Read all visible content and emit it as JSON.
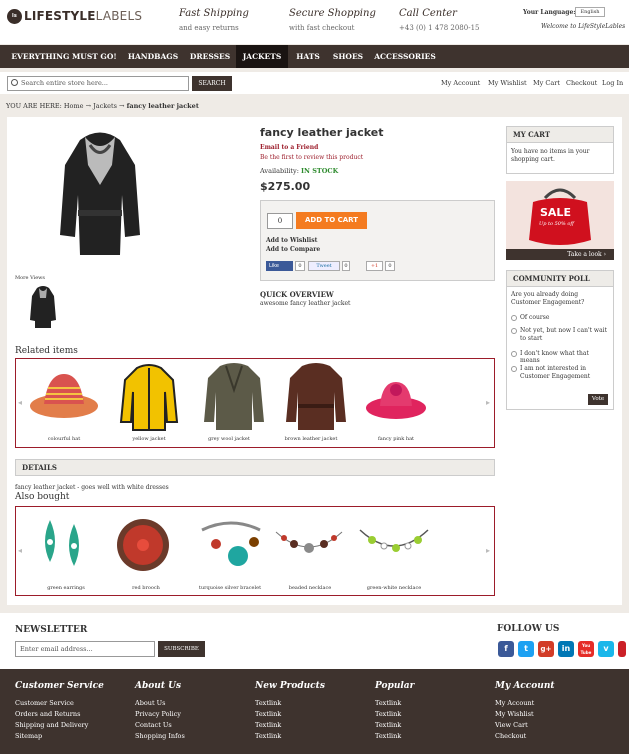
{
  "header": {
    "logo_text_bold": "LIFESTYLE",
    "logo_text_light": "LABELS",
    "logo_badge": "ls",
    "promo": [
      {
        "title": "Fast Shipping",
        "sub": "and easy returns"
      },
      {
        "title": "Secure Shopping",
        "sub": "with fast checkout"
      },
      {
        "title": "Call Center",
        "sub": "+43 (0) 1 478 2080-15"
      }
    ],
    "language_label": "Your Language:",
    "language_value": "English",
    "welcome": "Welcome to LifeStyleLables"
  },
  "nav": [
    "EVERYTHING MUST GO!",
    "HANDBAGS",
    "DRESSES",
    "JACKETS",
    "HATS",
    "SHOES",
    "ACCESSORIES"
  ],
  "search": {
    "placeholder": "Search entire store here...",
    "button": "SEARCH"
  },
  "account_links": [
    "My Account",
    "My Wishlist",
    "My Cart",
    "Checkout",
    "Log In"
  ],
  "breadcrumb": {
    "prefix": "YOU ARE HERE:",
    "home": "Home",
    "sep": "→",
    "cat": "Jackets",
    "current": "fancy leather jacket"
  },
  "product": {
    "name": "fancy leather jacket",
    "email": "Email to a Friend",
    "review": "Be the first to review this product",
    "availability_label": "Availability:",
    "availability_value": "IN STOCK",
    "price": "$275.00",
    "qty": "0",
    "add_to_cart": "ADD TO CART",
    "wishlist": "Add to Wishlist",
    "compare": "Add to Compare",
    "like": "Like",
    "like_count": "0",
    "tweet": "Tweet",
    "tweet_count": "0",
    "gplus": "+1",
    "gplus_count": "0",
    "more_views": "More Views",
    "quick_overview_title": "QUICK OVERVIEW",
    "quick_overview_text": "awesome fancy leather jacket"
  },
  "related": {
    "title": "Related items",
    "items": [
      "colourful hat",
      "yellow jacket",
      "grey wool jacket",
      "brown leather jacket",
      "fancy pink hat"
    ]
  },
  "details": {
    "title": "DETAILS",
    "text": "fancy leather jacket - goes well with white dresses"
  },
  "also": {
    "title": "Also bought",
    "items": [
      "green earrings",
      "red brooch",
      "turquoise silver bracelet",
      "beaded necklace",
      "green-white necklace"
    ]
  },
  "cart": {
    "title": "MY CART",
    "text": "You have no items in your shopping cart."
  },
  "sale": {
    "text": "SALE",
    "sub": "Up to 50% off",
    "link": "Take a look ›"
  },
  "poll": {
    "title": "COMMUNITY POLL",
    "question": "Are you already doing Customer Engagement?",
    "options": [
      "Of course",
      "Not yet, but now I can't wait to start",
      "I don't know what that means",
      "I am not interested in Customer Engagement"
    ],
    "vote": "Vote"
  },
  "newsletter": {
    "title": "NEWSLETTER",
    "placeholder": "Enter email address...",
    "button": "SUBSCRIBE"
  },
  "follow": {
    "title": "FOLLOW US",
    "icons": [
      "f",
      "t",
      "g+",
      "in",
      "You Tube",
      "v",
      "P"
    ]
  },
  "footer": [
    {
      "title": "Customer Service",
      "links": [
        "Customer Service",
        "Orders and Returns",
        "Shipping and Delivery",
        "Sitemap"
      ]
    },
    {
      "title": "About Us",
      "links": [
        "About Us",
        "Privacy Policy",
        "Contact Us",
        "Shopping Infos"
      ]
    },
    {
      "title": "New Products",
      "links": [
        "Textlink",
        "Textlink",
        "Textlink",
        "Textlink"
      ]
    },
    {
      "title": "Popular",
      "links": [
        "Textlink",
        "Textlink",
        "Textlink",
        "Textlink"
      ]
    },
    {
      "title": "My Account",
      "links": [
        "My Account",
        "My Wishlist",
        "View Cart",
        "Checkout"
      ]
    }
  ],
  "colors": {
    "dark_brown": "#3e332e",
    "accent_orange": "#f47b20",
    "carousel_border": "#9c1c2a",
    "stock_green": "#2e8b2e",
    "link_red": "#9c1c2a"
  }
}
